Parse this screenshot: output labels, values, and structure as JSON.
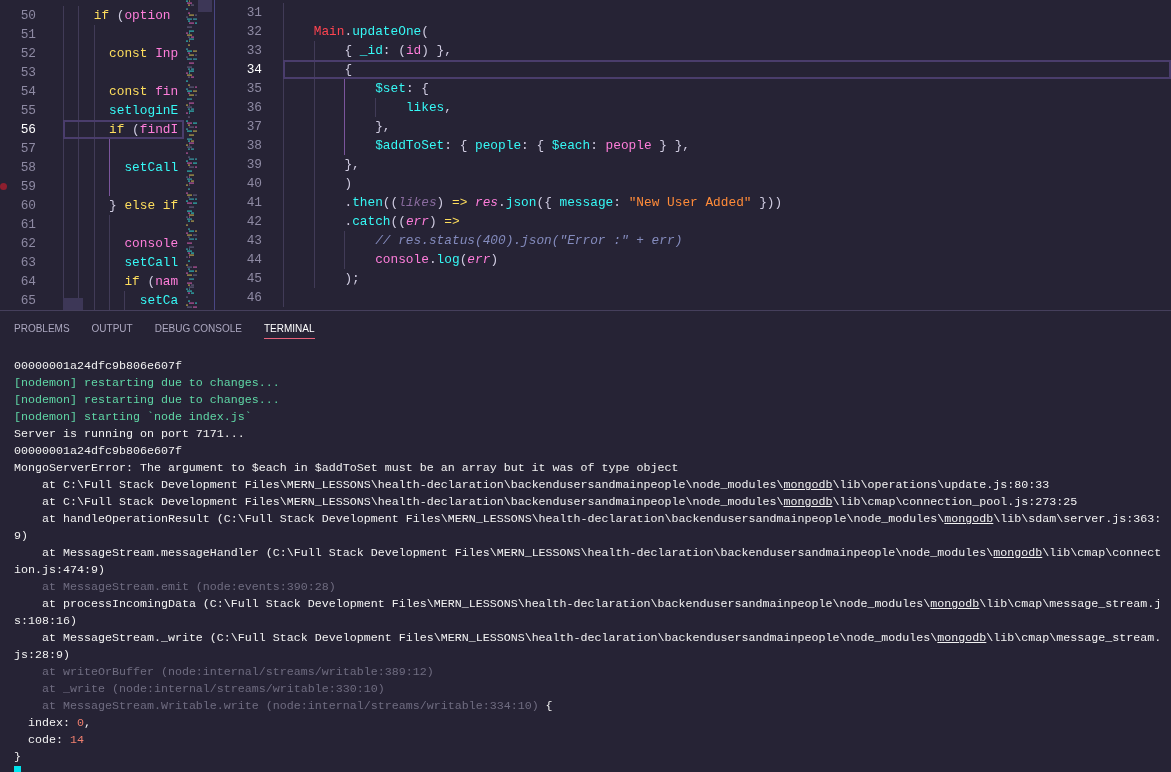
{
  "editors": [
    {
      "lines": [
        {
          "number": "50",
          "active": false,
          "breakpoint": false,
          "tokens": [
            {
              "text": "    if",
              "kind": "keyword"
            },
            {
              "text": " (",
              "kind": "punct"
            },
            {
              "text": "option",
              "kind": "variable"
            }
          ]
        },
        {
          "number": "51",
          "active": false,
          "breakpoint": false
        },
        {
          "number": "52",
          "active": false,
          "breakpoint": false,
          "tokens": [
            {
              "text": "      const",
              "kind": "keyword"
            },
            {
              "text": " Inp",
              "kind": "variable"
            }
          ]
        },
        {
          "number": "53",
          "active": false,
          "breakpoint": false
        },
        {
          "number": "54",
          "active": false,
          "breakpoint": false,
          "tokens": [
            {
              "text": "      const",
              "kind": "keyword"
            },
            {
              "text": " fin",
              "kind": "variable"
            }
          ]
        },
        {
          "number": "55",
          "active": false,
          "breakpoint": false,
          "tokens": [
            {
              "text": "      setloginE",
              "kind": "member"
            }
          ]
        },
        {
          "number": "56",
          "active": true,
          "breakpoint": false,
          "tokens": [
            {
              "text": "      if",
              "kind": "keyword"
            },
            {
              "text": " (",
              "kind": "punct"
            },
            {
              "text": "findI",
              "kind": "variable"
            }
          ]
        },
        {
          "number": "57",
          "active": false,
          "breakpoint": false
        },
        {
          "number": "58",
          "active": false,
          "breakpoint": false,
          "tokens": [
            {
              "text": "        setCall",
              "kind": "member"
            }
          ]
        },
        {
          "number": "59",
          "active": false,
          "breakpoint": true
        },
        {
          "number": "60",
          "active": false,
          "breakpoint": false,
          "tokens": [
            {
              "text": "      }",
              "kind": "punct"
            },
            {
              "text": " else if",
              "kind": "keyword"
            }
          ]
        },
        {
          "number": "61",
          "active": false,
          "breakpoint": false
        },
        {
          "number": "62",
          "active": false,
          "breakpoint": false,
          "tokens": [
            {
              "text": "        console",
              "kind": "variable"
            }
          ]
        },
        {
          "number": "63",
          "active": false,
          "breakpoint": false,
          "tokens": [
            {
              "text": "        setCall",
              "kind": "member"
            }
          ]
        },
        {
          "number": "64",
          "active": false,
          "breakpoint": false,
          "tokens": [
            {
              "text": "        if",
              "kind": "keyword"
            },
            {
              "text": " (",
              "kind": "punct"
            },
            {
              "text": "nam",
              "kind": "variable"
            }
          ]
        },
        {
          "number": "65",
          "active": false,
          "breakpoint": false,
          "tokens": [
            {
              "text": "          setCa",
              "kind": "member"
            }
          ]
        }
      ]
    },
    {
      "lines": [
        {
          "number": "31",
          "active": false,
          "breakpoint": false
        },
        {
          "number": "32",
          "active": false,
          "breakpoint": false,
          "tokens": [
            {
              "text": "    Main",
              "kind": "class"
            },
            {
              "text": ".",
              "kind": "punct"
            },
            {
              "text": "updateOne",
              "kind": "member"
            },
            {
              "text": "(",
              "kind": "punct"
            }
          ]
        },
        {
          "number": "33",
          "active": false,
          "breakpoint": false,
          "tokens": [
            {
              "text": "        { ",
              "kind": "punct"
            },
            {
              "text": "_id",
              "kind": "member"
            },
            {
              "text": ": (",
              "kind": "punct"
            },
            {
              "text": "id",
              "kind": "variable"
            },
            {
              "text": ") },",
              "kind": "punct"
            }
          ]
        },
        {
          "number": "34",
          "active": true,
          "breakpoint": false,
          "tokens": [
            {
              "text": "        {",
              "kind": "punct"
            }
          ]
        },
        {
          "number": "35",
          "active": false,
          "breakpoint": false,
          "tokens": [
            {
              "text": "            $set",
              "kind": "member"
            },
            {
              "text": ": {",
              "kind": "punct"
            }
          ]
        },
        {
          "number": "36",
          "active": false,
          "breakpoint": false,
          "tokens": [
            {
              "text": "                likes",
              "kind": "member"
            },
            {
              "text": ",",
              "kind": "punct"
            }
          ]
        },
        {
          "number": "37",
          "active": false,
          "breakpoint": false,
          "tokens": [
            {
              "text": "            },",
              "kind": "punct"
            }
          ]
        },
        {
          "number": "38",
          "active": false,
          "breakpoint": false,
          "tokens": [
            {
              "text": "            $addToSet",
              "kind": "member"
            },
            {
              "text": ": { ",
              "kind": "punct"
            },
            {
              "text": "people",
              "kind": "member"
            },
            {
              "text": ": { ",
              "kind": "punct"
            },
            {
              "text": "$each",
              "kind": "member"
            },
            {
              "text": ": ",
              "kind": "punct"
            },
            {
              "text": "people",
              "kind": "variable"
            },
            {
              "text": " } },",
              "kind": "punct"
            }
          ]
        },
        {
          "number": "39",
          "active": false,
          "breakpoint": false,
          "tokens": [
            {
              "text": "        },",
              "kind": "punct"
            }
          ]
        },
        {
          "number": "40",
          "active": false,
          "breakpoint": false,
          "tokens": [
            {
              "text": "        )",
              "kind": "punct"
            }
          ]
        },
        {
          "number": "41",
          "active": false,
          "breakpoint": false,
          "tokens": [
            {
              "text": "        .",
              "kind": "punct"
            },
            {
              "text": "then",
              "kind": "member"
            },
            {
              "text": "((",
              "kind": "punct"
            },
            {
              "text": "likes",
              "kind": "unused"
            },
            {
              "text": ")",
              "kind": "punct"
            },
            {
              "text": " => ",
              "kind": "keyword"
            },
            {
              "text": "res",
              "kind": "param"
            },
            {
              "text": ".",
              "kind": "punct"
            },
            {
              "text": "json",
              "kind": "member"
            },
            {
              "text": "({ ",
              "kind": "punct"
            },
            {
              "text": "message",
              "kind": "member"
            },
            {
              "text": ": ",
              "kind": "punct"
            },
            {
              "text": "\"New User Added\"",
              "kind": "string"
            },
            {
              "text": " }))",
              "kind": "punct"
            }
          ]
        },
        {
          "number": "42",
          "active": false,
          "breakpoint": false,
          "tokens": [
            {
              "text": "        .",
              "kind": "punct"
            },
            {
              "text": "catch",
              "kind": "member"
            },
            {
              "text": "((",
              "kind": "punct"
            },
            {
              "text": "err",
              "kind": "param"
            },
            {
              "text": ")",
              "kind": "punct"
            },
            {
              "text": " =>",
              "kind": "keyword"
            }
          ]
        },
        {
          "number": "43",
          "active": false,
          "breakpoint": false,
          "tokens": [
            {
              "text": "            // res.status(400).json(\"Error :\" + err)",
              "kind": "comment"
            }
          ]
        },
        {
          "number": "44",
          "active": false,
          "breakpoint": false,
          "tokens": [
            {
              "text": "            console",
              "kind": "variable"
            },
            {
              "text": ".",
              "kind": "punct"
            },
            {
              "text": "log",
              "kind": "member"
            },
            {
              "text": "(",
              "kind": "punct"
            },
            {
              "text": "err",
              "kind": "param"
            },
            {
              "text": ")",
              "kind": "punct"
            }
          ]
        },
        {
          "number": "45",
          "active": false,
          "breakpoint": false,
          "tokens": [
            {
              "text": "        );",
              "kind": "punct"
            }
          ]
        },
        {
          "number": "46",
          "active": false,
          "breakpoint": false
        }
      ]
    }
  ],
  "panel": {
    "tabs": [
      {
        "label": "PROBLEMS",
        "selected": false
      },
      {
        "label": "OUTPUT",
        "selected": false
      },
      {
        "label": "DEBUG CONSOLE",
        "selected": false
      },
      {
        "label": "TERMINAL",
        "selected": true
      }
    ],
    "terminal": {
      "lines": [
        {
          "segments": [
            {
              "text": "00000001a24dfc9b806e607f",
              "kind": "text"
            }
          ]
        },
        {
          "segments": [
            {
              "text": "[nodemon] restarting due to changes...",
              "kind": "nodemon"
            }
          ]
        },
        {
          "segments": [
            {
              "text": "[nodemon] restarting due to changes...",
              "kind": "nodemon"
            }
          ]
        },
        {
          "segments": [
            {
              "text": "[nodemon] starting `node index.js`",
              "kind": "nodemon"
            }
          ]
        },
        {
          "segments": [
            {
              "text": "Server is running on port 7171...",
              "kind": "text"
            }
          ]
        },
        {
          "segments": [
            {
              "text": "00000001a24dfc9b806e607f",
              "kind": "text"
            }
          ]
        },
        {
          "segments": [
            {
              "text": "MongoServerError: The argument to $each in $addToSet must be an array but it was of type object",
              "kind": "text"
            }
          ]
        },
        {
          "segments": [
            {
              "text": "    at C:\\Full Stack Development Files\\MERN_LESSONS\\health-declaration\\backendusersandmainpeople\\node_modules\\",
              "kind": "text"
            },
            {
              "text": "mongodb",
              "kind": "link"
            },
            {
              "text": "\\lib\\operations\\update.js:80:33",
              "kind": "text"
            }
          ]
        },
        {
          "segments": [
            {
              "text": "    at C:\\Full Stack Development Files\\MERN_LESSONS\\health-declaration\\backendusersandmainpeople\\node_modules\\",
              "kind": "text"
            },
            {
              "text": "mongodb",
              "kind": "link"
            },
            {
              "text": "\\lib\\cmap\\connection_pool.js:273:25",
              "kind": "text"
            }
          ]
        },
        {
          "segments": [
            {
              "text": "    at handleOperationResult (C:\\Full Stack Development Files\\MERN_LESSONS\\health-declaration\\backendusersandmainpeople\\node_modules\\",
              "kind": "text"
            },
            {
              "text": "mongodb",
              "kind": "link"
            },
            {
              "text": "\\lib\\sdam\\server.js:363:",
              "kind": "text"
            }
          ]
        },
        {
          "segments": [
            {
              "text": "9)",
              "kind": "text"
            }
          ]
        },
        {
          "segments": [
            {
              "text": "    at MessageStream.messageHandler (C:\\Full Stack Development Files\\MERN_LESSONS\\health-declaration\\backendusersandmainpeople\\node_modules\\",
              "kind": "text"
            },
            {
              "text": "mongodb",
              "kind": "link"
            },
            {
              "text": "\\lib\\cmap\\connect",
              "kind": "text"
            }
          ]
        },
        {
          "segments": [
            {
              "text": "ion.js:474:9)",
              "kind": "text"
            }
          ]
        },
        {
          "segments": [
            {
              "text": "    at MessageStream.emit (node:events:390:28)",
              "kind": "internal"
            }
          ]
        },
        {
          "segments": [
            {
              "text": "    at processIncomingData (C:\\Full Stack Development Files\\MERN_LESSONS\\health-declaration\\backendusersandmainpeople\\node_modules\\",
              "kind": "text"
            },
            {
              "text": "mongodb",
              "kind": "link"
            },
            {
              "text": "\\lib\\cmap\\message_stream.j",
              "kind": "text"
            }
          ]
        },
        {
          "segments": [
            {
              "text": "s:108:16)",
              "kind": "text"
            }
          ]
        },
        {
          "segments": [
            {
              "text": "    at MessageStream._write (C:\\Full Stack Development Files\\MERN_LESSONS\\health-declaration\\backendusersandmainpeople\\node_modules\\",
              "kind": "text"
            },
            {
              "text": "mongodb",
              "kind": "link"
            },
            {
              "text": "\\lib\\cmap\\message_stream.",
              "kind": "text"
            }
          ]
        },
        {
          "segments": [
            {
              "text": "js:28:9)",
              "kind": "text"
            }
          ]
        },
        {
          "segments": [
            {
              "text": "    at writeOrBuffer (node:internal/streams/writable:389:12)",
              "kind": "internal"
            }
          ]
        },
        {
          "segments": [
            {
              "text": "    at _write (node:internal/streams/writable:330:10)",
              "kind": "internal"
            }
          ]
        },
        {
          "segments": [
            {
              "text": "    at MessageStream.Writable.write (node:internal/streams/writable:334:10)",
              "kind": "internal"
            },
            {
              "text": " {",
              "kind": "text"
            }
          ]
        },
        {
          "segments": [
            {
              "text": "  index: ",
              "kind": "text"
            },
            {
              "text": "0",
              "kind": "number"
            },
            {
              "text": ",",
              "kind": "text"
            }
          ]
        },
        {
          "segments": [
            {
              "text": "  code: ",
              "kind": "text"
            },
            {
              "text": "14",
              "kind": "number"
            }
          ]
        },
        {
          "segments": [
            {
              "text": "}",
              "kind": "text"
            }
          ]
        }
      ]
    }
  }
}
